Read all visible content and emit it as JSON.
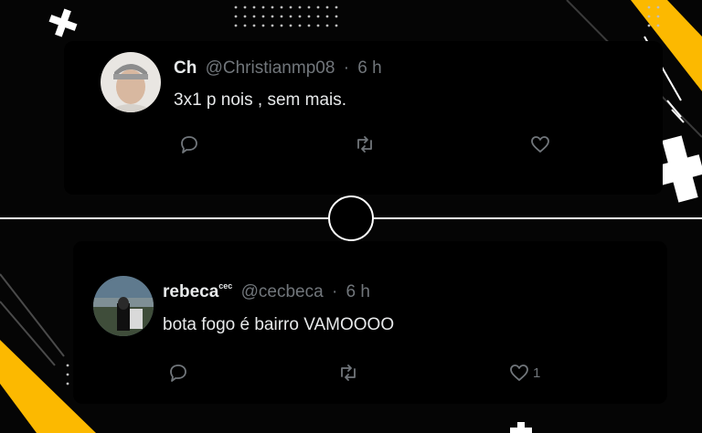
{
  "colors": {
    "accent": "#fcb900",
    "text": "#e7e9ea",
    "muted": "#71767b",
    "background": "#000000"
  },
  "posts": [
    {
      "display_name": "Ch",
      "handle": "@Christianmp08",
      "separator": "·",
      "time": "6 h",
      "text": "3x1 p nois , sem mais.",
      "actions": {
        "reply_icon": "reply-icon",
        "repost_icon": "repost-icon",
        "like_icon": "like-icon",
        "like_count": ""
      }
    },
    {
      "display_name": "rebeca",
      "display_name_suffix": "cec",
      "handle": "@cecbeca",
      "separator": "·",
      "time": "6 h",
      "text": "bota fogo é bairro VAMOOOO",
      "actions": {
        "reply_icon": "reply-icon",
        "repost_icon": "repost-icon",
        "like_icon": "like-icon",
        "like_count": "1"
      }
    }
  ]
}
